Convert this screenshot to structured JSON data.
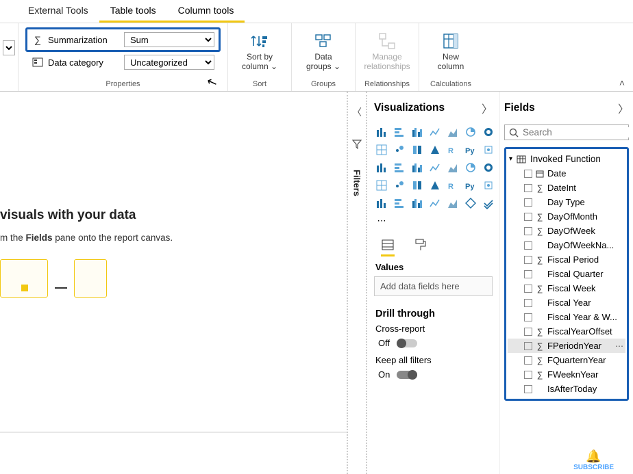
{
  "tabs": {
    "external": "External Tools",
    "table": "Table tools",
    "column": "Column tools"
  },
  "ribbon": {
    "props": {
      "summ_label": "Summarization",
      "summ_value": "Sum",
      "cat_label": "Data category",
      "cat_value": "Uncategorized",
      "group_label": "Properties"
    },
    "sort": {
      "line1": "Sort by",
      "line2": "column",
      "group_label": "Sort"
    },
    "groups": {
      "line1": "Data",
      "line2": "groups",
      "group_label": "Groups"
    },
    "rel": {
      "line1": "Manage",
      "line2": "relationships",
      "group_label": "Relationships"
    },
    "calc": {
      "line1": "New",
      "line2": "column",
      "group_label": "Calculations"
    }
  },
  "canvas": {
    "heading": "visuals with your data",
    "hint_pre": "m the ",
    "hint_bold": "Fields",
    "hint_post": " pane onto the report canvas."
  },
  "filters_label": "Filters",
  "viz": {
    "title": "Visualizations",
    "values_label": "Values",
    "dropzone": "Add data fields here",
    "drill_label": "Drill through",
    "cross_label": "Cross-report",
    "off": "Off",
    "keep_label": "Keep all filters",
    "on": "On"
  },
  "fields": {
    "title": "Fields",
    "search_placeholder": "Search",
    "table": "Invoked Function",
    "items": [
      {
        "name": "Date",
        "sigma": false,
        "dateicon": true
      },
      {
        "name": "DateInt",
        "sigma": true
      },
      {
        "name": "Day Type",
        "sigma": false
      },
      {
        "name": "DayOfMonth",
        "sigma": true
      },
      {
        "name": "DayOfWeek",
        "sigma": true
      },
      {
        "name": "DayOfWeekNa...",
        "sigma": false
      },
      {
        "name": "Fiscal Period",
        "sigma": true
      },
      {
        "name": "Fiscal Quarter",
        "sigma": false
      },
      {
        "name": "Fiscal Week",
        "sigma": true
      },
      {
        "name": "Fiscal Year",
        "sigma": false
      },
      {
        "name": "Fiscal Year & W...",
        "sigma": false
      },
      {
        "name": "FiscalYearOffset",
        "sigma": true
      },
      {
        "name": "FPeriodnYear",
        "sigma": true,
        "selected": true
      },
      {
        "name": "FQuarternYear",
        "sigma": true
      },
      {
        "name": "FWeeknYear",
        "sigma": true
      },
      {
        "name": "IsAfterToday",
        "sigma": false
      }
    ]
  },
  "subscribe": "SUBSCRIBE"
}
